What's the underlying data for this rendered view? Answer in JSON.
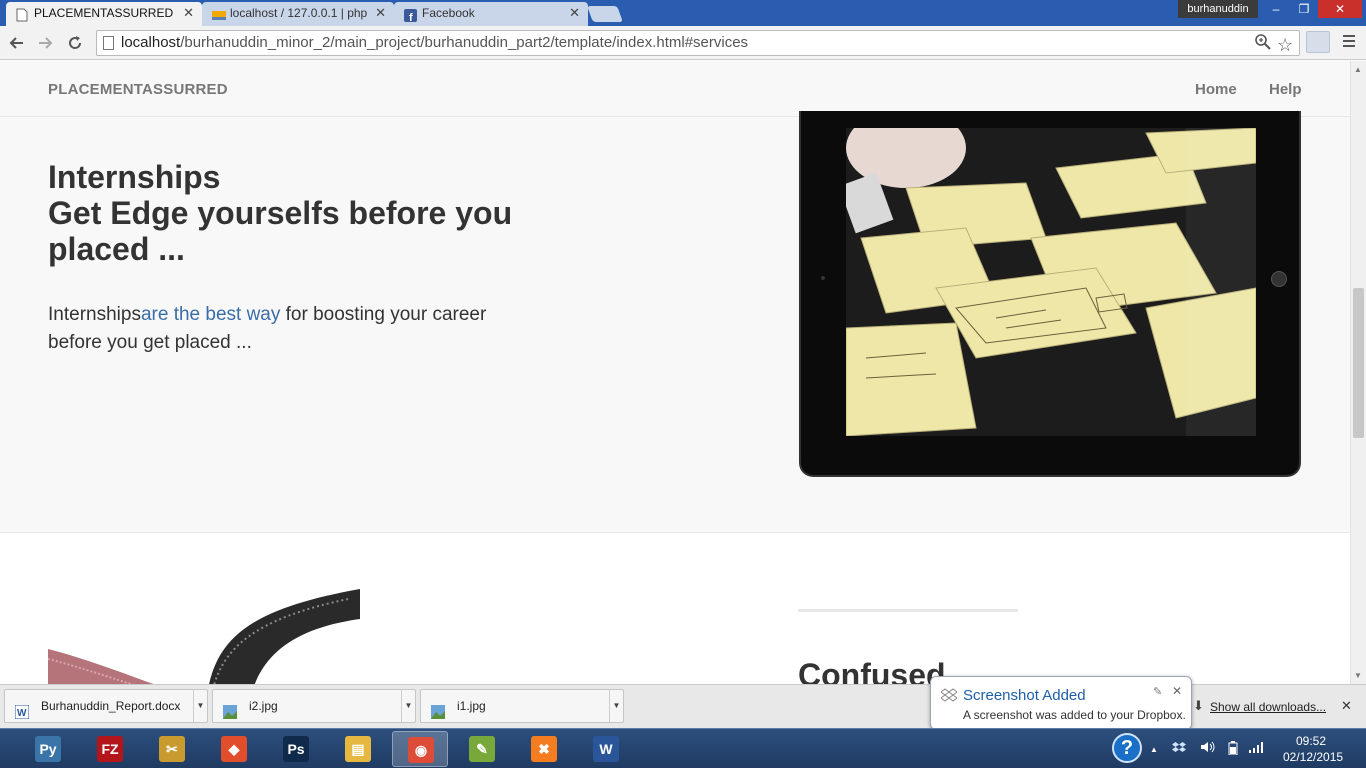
{
  "browser": {
    "tabs": [
      {
        "title": "PLACEMENTASSURRED",
        "active": true
      },
      {
        "title": "localhost / 127.0.0.1 | php",
        "active": false
      },
      {
        "title": "Facebook",
        "active": false
      }
    ],
    "tab_close": "✕",
    "user": "burhanuddin",
    "window_buttons": {
      "minimize": "–",
      "maximize": "❐",
      "close": "✕"
    },
    "url_host": "localhost",
    "url_path": "/burhanuddin_minor_2/main_project/burhanuddin_part2/template/index.html#services",
    "icons": {
      "back": "back-arrow-icon",
      "forward": "forward-arrow-icon",
      "reload": "reload-icon",
      "zoom": "zoom-icon",
      "star": "star-icon",
      "menu": "hamburger-menu-icon"
    }
  },
  "site": {
    "brand": "PLACEMENTASSURRED",
    "nav": [
      {
        "label": "Home"
      },
      {
        "label": "Help"
      }
    ],
    "section1": {
      "heading_lines": [
        "Internships",
        "Get Edge yourselfs before you",
        "placed ..."
      ],
      "lead_before": "Internships",
      "lead_link": "are the best way",
      "lead_after": " for boosting your career before you get placed ..."
    },
    "section2": {
      "heading": "Confused"
    }
  },
  "downloads": {
    "items": [
      {
        "name": "Burhanuddin_Report.docx",
        "icon": "word-doc-icon"
      },
      {
        "name": "i2.jpg",
        "icon": "image-file-icon"
      },
      {
        "name": "i1.jpg",
        "icon": "image-file-icon"
      }
    ],
    "show_all": "Show all downloads...",
    "close": "✕"
  },
  "notification": {
    "title": "Screenshot Added",
    "body": "A screenshot was added to your Dropbox.",
    "close": "✕"
  },
  "taskbar": {
    "apps": [
      {
        "name": "python-icon",
        "glyph": "Py",
        "color": "#3a74a8",
        "active": false
      },
      {
        "name": "filezilla-icon",
        "glyph": "FZ",
        "color": "#b3151a",
        "active": false
      },
      {
        "name": "tools-icon",
        "glyph": "✂",
        "color": "#c99a2e",
        "active": false
      },
      {
        "name": "git-icon",
        "glyph": "◆",
        "color": "#e04e2b",
        "active": false
      },
      {
        "name": "photoshop-icon",
        "glyph": "Ps",
        "color": "#0f2a4a",
        "active": false
      },
      {
        "name": "file-explorer-icon",
        "glyph": "▤",
        "color": "#e6b840",
        "active": false
      },
      {
        "name": "chrome-icon",
        "glyph": "◉",
        "color": "#dd4b39",
        "active": true
      },
      {
        "name": "notepad-plus-icon",
        "glyph": "✎",
        "color": "#78a83a",
        "active": false
      },
      {
        "name": "xampp-icon",
        "glyph": "✖",
        "color": "#f57c1f",
        "active": false
      },
      {
        "name": "word-icon",
        "glyph": "W",
        "color": "#2a5699",
        "active": false
      }
    ],
    "help": "?",
    "time": "09:52",
    "date": "02/12/2015"
  }
}
